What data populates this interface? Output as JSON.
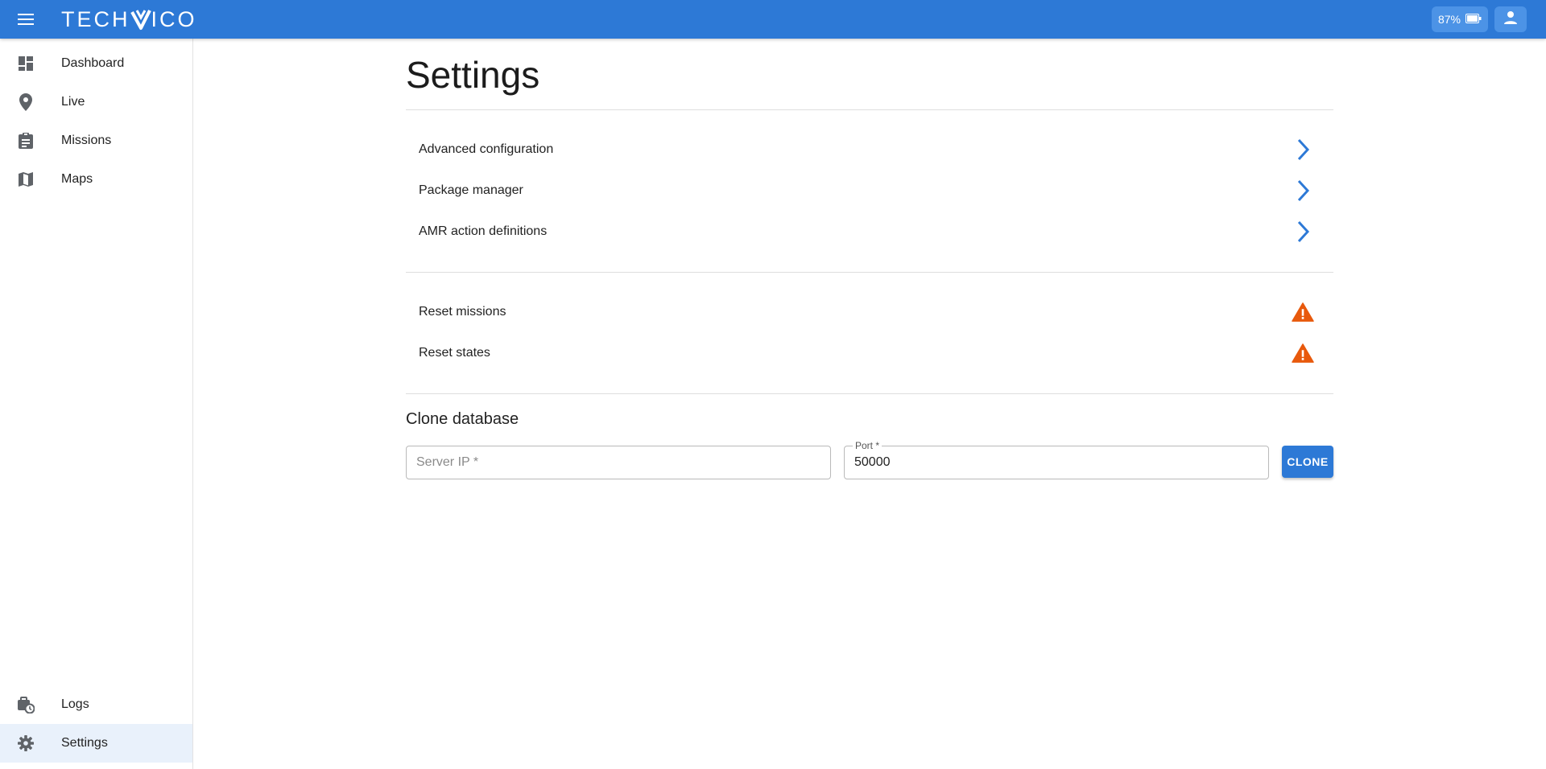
{
  "header": {
    "brand": {
      "left": "TECH",
      "right": "ICO"
    },
    "battery_text": "87%",
    "colors": {
      "bar": "#2d79d6",
      "chip": "#4c93e6"
    }
  },
  "sidebar": {
    "items": [
      {
        "label": "Dashboard",
        "icon": "dashboard-icon"
      },
      {
        "label": "Live",
        "icon": "location-pin-icon"
      },
      {
        "label": "Missions",
        "icon": "clipboard-icon"
      },
      {
        "label": "Maps",
        "icon": "map-icon"
      }
    ],
    "bottom_items": [
      {
        "label": "Logs",
        "icon": "logs-icon"
      },
      {
        "label": "Settings",
        "icon": "gear-icon",
        "active": true
      }
    ]
  },
  "main": {
    "title": "Settings",
    "links": [
      {
        "label": "Advanced configuration",
        "icon": "chevron-right-icon"
      },
      {
        "label": "Package manager",
        "icon": "chevron-right-icon"
      },
      {
        "label": "AMR action definitions",
        "icon": "chevron-right-icon"
      }
    ],
    "resets": [
      {
        "label": "Reset missions",
        "icon": "warning-icon"
      },
      {
        "label": "Reset states",
        "icon": "warning-icon"
      }
    ],
    "clone": {
      "title": "Clone database",
      "server_ip_placeholder": "Server IP *",
      "server_ip_value": "",
      "port_label": "Port *",
      "port_value": "50000",
      "button_label": "CLONE"
    },
    "colors": {
      "accent": "#2d79d6",
      "warning": "#e8590c"
    }
  }
}
